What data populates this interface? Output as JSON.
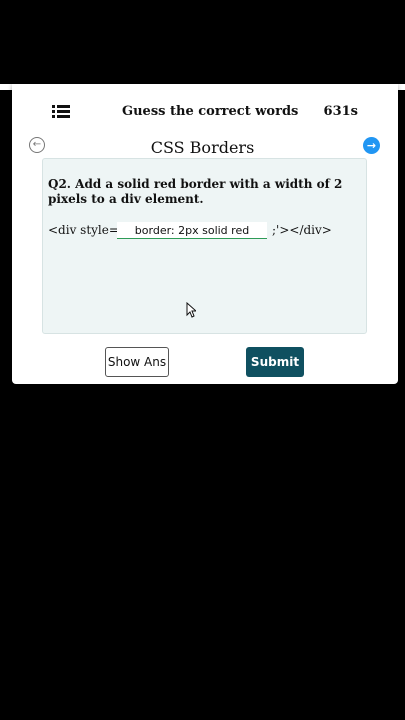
{
  "header": {
    "title": "Guess the correct words",
    "timer": "631s"
  },
  "topic": "CSS Borders",
  "question": {
    "text": "Q2. Add a solid red border with a width of 2 pixels to a div element.",
    "code_prefix": "<div style='",
    "answer_value": "border: 2px solid red",
    "code_suffix": ";'></div>"
  },
  "nav": {
    "prev_icon": "←",
    "next_icon": "→"
  },
  "buttons": {
    "show_ans": "Show Ans",
    "submit": "Submit"
  },
  "colors": {
    "accent_blue": "#2196f3",
    "submit_bg": "#0f5060",
    "panel_bg": "#eef5f5",
    "input_underline": "#2e9b57"
  }
}
